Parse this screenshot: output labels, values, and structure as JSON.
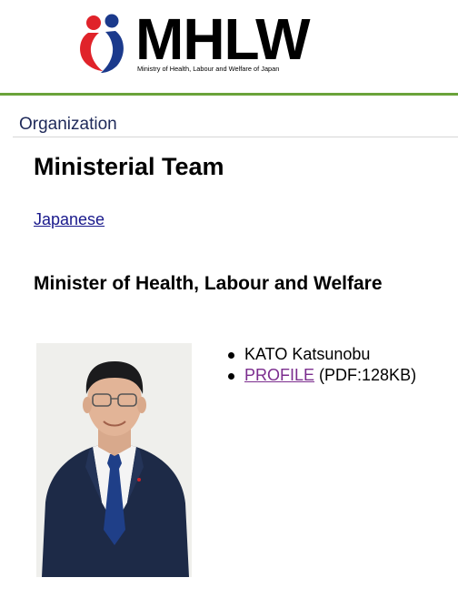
{
  "header": {
    "logo_text": "MHLW",
    "logo_subtitle": "Ministry of Health, Labour and Welfare of Japan",
    "colors": {
      "logo_red": "#e0232a",
      "logo_blue": "#1b3a8c",
      "rule_green": "#6aa33a"
    }
  },
  "breadcrumb": "Organization",
  "page_title": "Ministerial Team",
  "language_link": "Japanese",
  "section_title": "Minister of Health, Labour and Welfare",
  "minister": {
    "name": "KATO Katsunobu",
    "profile_link": "PROFILE",
    "profile_meta": " (PDF:128KB)"
  },
  "icons": {
    "logo": "mhlw-logo-icon",
    "portrait": "minister-portrait"
  }
}
